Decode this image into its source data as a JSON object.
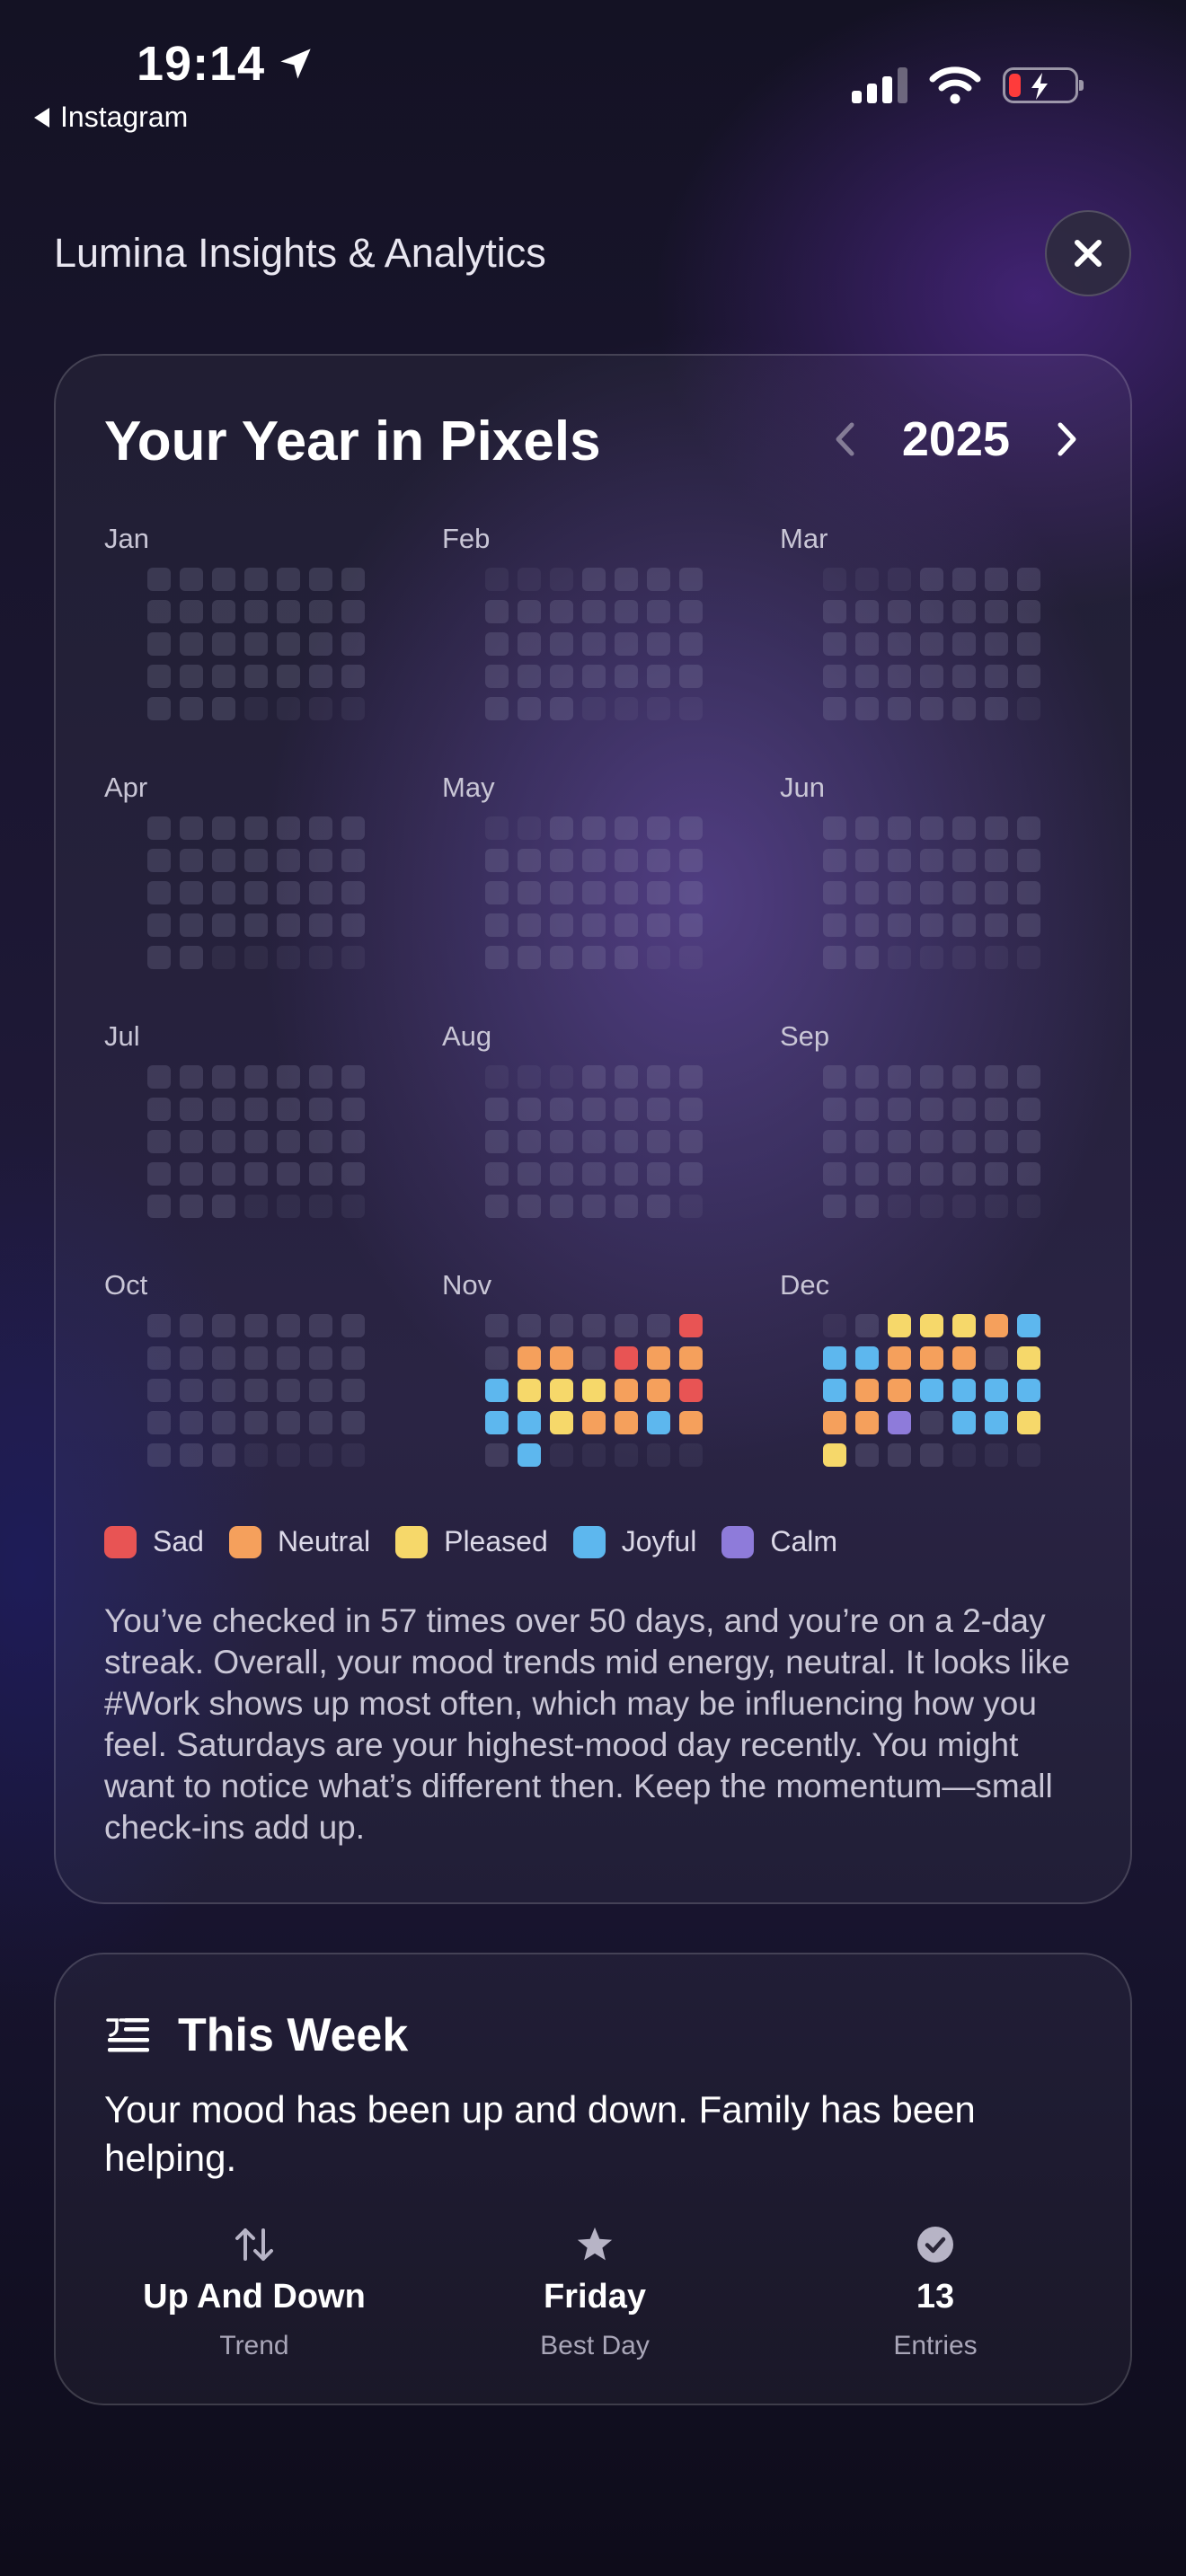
{
  "status_bar": {
    "time": "19:14",
    "back_label": "Instagram",
    "battery_level": 0.2
  },
  "header": {
    "title": "Lumina Insights & Analytics"
  },
  "year_pixels": {
    "title": "Your Year in Pixels",
    "year": "2025",
    "colors": {
      "sad": "#E85454",
      "neutral": "#F5A05C",
      "pleased": "#F6D86A",
      "joyful": "#5DB7EE",
      "calm": "#8E7BDA"
    },
    "months": [
      {
        "label": "Jan",
        "offset": 0,
        "days": 31,
        "moods": []
      },
      {
        "label": "Feb",
        "offset": 3,
        "days": 28,
        "moods": []
      },
      {
        "label": "Mar",
        "offset": 3,
        "days": 31,
        "moods": []
      },
      {
        "label": "Apr",
        "offset": 0,
        "days": 30,
        "moods": []
      },
      {
        "label": "May",
        "offset": 2,
        "days": 31,
        "moods": []
      },
      {
        "label": "Jun",
        "offset": 0,
        "days": 30,
        "moods": []
      },
      {
        "label": "Jul",
        "offset": 0,
        "days": 31,
        "moods": []
      },
      {
        "label": "Aug",
        "offset": 3,
        "days": 31,
        "moods": []
      },
      {
        "label": "Sep",
        "offset": 0,
        "days": 30,
        "moods": []
      },
      {
        "label": "Oct",
        "offset": 0,
        "days": 31,
        "moods": []
      },
      {
        "label": "Nov",
        "offset": 0,
        "days": 30,
        "moods": [
          "",
          "",
          "",
          "",
          "",
          "",
          "sad",
          "",
          "neutral",
          "neutral",
          "",
          "sad",
          "neutral",
          "neutral",
          "joyful",
          "pleased",
          "pleased",
          "pleased",
          "neutral",
          "neutral",
          "sad",
          "joyful",
          "joyful",
          "pleased",
          "neutral",
          "neutral",
          "joyful",
          "neutral",
          "",
          "joyful"
        ]
      },
      {
        "label": "Dec",
        "offset": 1,
        "days": 31,
        "moods": [
          "",
          "pleased",
          "pleased",
          "pleased",
          "neutral",
          "joyful",
          "joyful",
          "joyful",
          "neutral",
          "neutral",
          "neutral",
          "",
          "pleased",
          "joyful",
          "neutral",
          "neutral",
          "joyful",
          "joyful",
          "joyful",
          "joyful",
          "neutral",
          "neutral",
          "calm",
          "",
          "joyful",
          "joyful",
          "pleased",
          "pleased",
          "",
          "",
          ""
        ]
      }
    ],
    "legend": [
      {
        "key": "sad",
        "label": "Sad"
      },
      {
        "key": "neutral",
        "label": "Neutral"
      },
      {
        "key": "pleased",
        "label": "Pleased"
      },
      {
        "key": "joyful",
        "label": "Joyful"
      },
      {
        "key": "calm",
        "label": "Calm"
      }
    ],
    "summary": "You’ve checked in 57 times over 50 days, and you’re on a 2-day streak. Overall, your mood trends mid energy, neutral. It looks like #Work shows up most often, which may be influencing how you feel. Saturdays are your highest-mood day recently. You might want to notice what’s different then. Keep the momentum—small check-ins add up."
  },
  "this_week": {
    "title": "This Week",
    "text": "Your mood has been up and down. Family has been helping.",
    "stats": [
      {
        "icon": "up-down-arrows-icon",
        "value": "Up And Down",
        "label": "Trend"
      },
      {
        "icon": "star-icon",
        "value": "Friday",
        "label": "Best Day"
      },
      {
        "icon": "checkmark-circle-icon",
        "value": "13",
        "label": "Entries"
      }
    ]
  }
}
